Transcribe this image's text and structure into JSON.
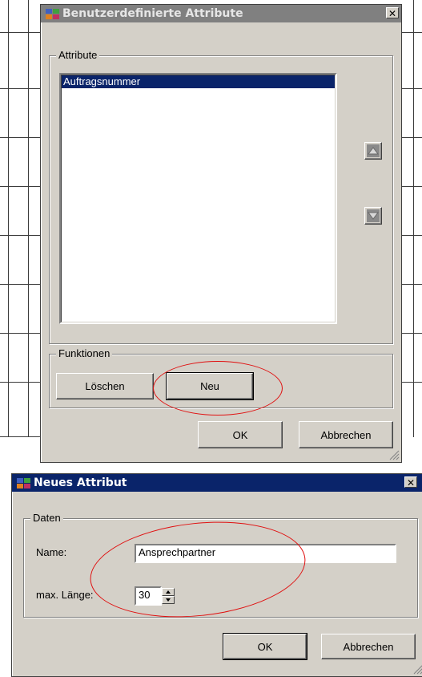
{
  "attr_dialog": {
    "title": "Benutzerdefinierte Attribute",
    "close_glyph": "✕",
    "attribute_group_label": "Attribute",
    "attributes": [
      "Auftragsnummer"
    ],
    "functions_group_label": "Funktionen",
    "delete_label": "Löschen",
    "new_label": "Neu",
    "ok_label": "OK",
    "cancel_label": "Abbrechen"
  },
  "new_dialog": {
    "title": "Neues Attribut",
    "close_glyph": "✕",
    "data_group_label": "Daten",
    "name_label": "Name:",
    "name_value": "Ansprechpartner",
    "maxlen_label": "max. Länge:",
    "maxlen_value": "30",
    "ok_label": "OK",
    "cancel_label": "Abbrechen"
  },
  "colors": {
    "window_face": "#d4d0c8",
    "active_title": "#0a246a",
    "inactive_title": "#808080",
    "selection": "#0a246a",
    "annotation": "#e01010"
  },
  "icons": {
    "app": "app-icon",
    "close": "close-icon",
    "up": "arrow-up-icon",
    "down": "arrow-down-icon"
  }
}
